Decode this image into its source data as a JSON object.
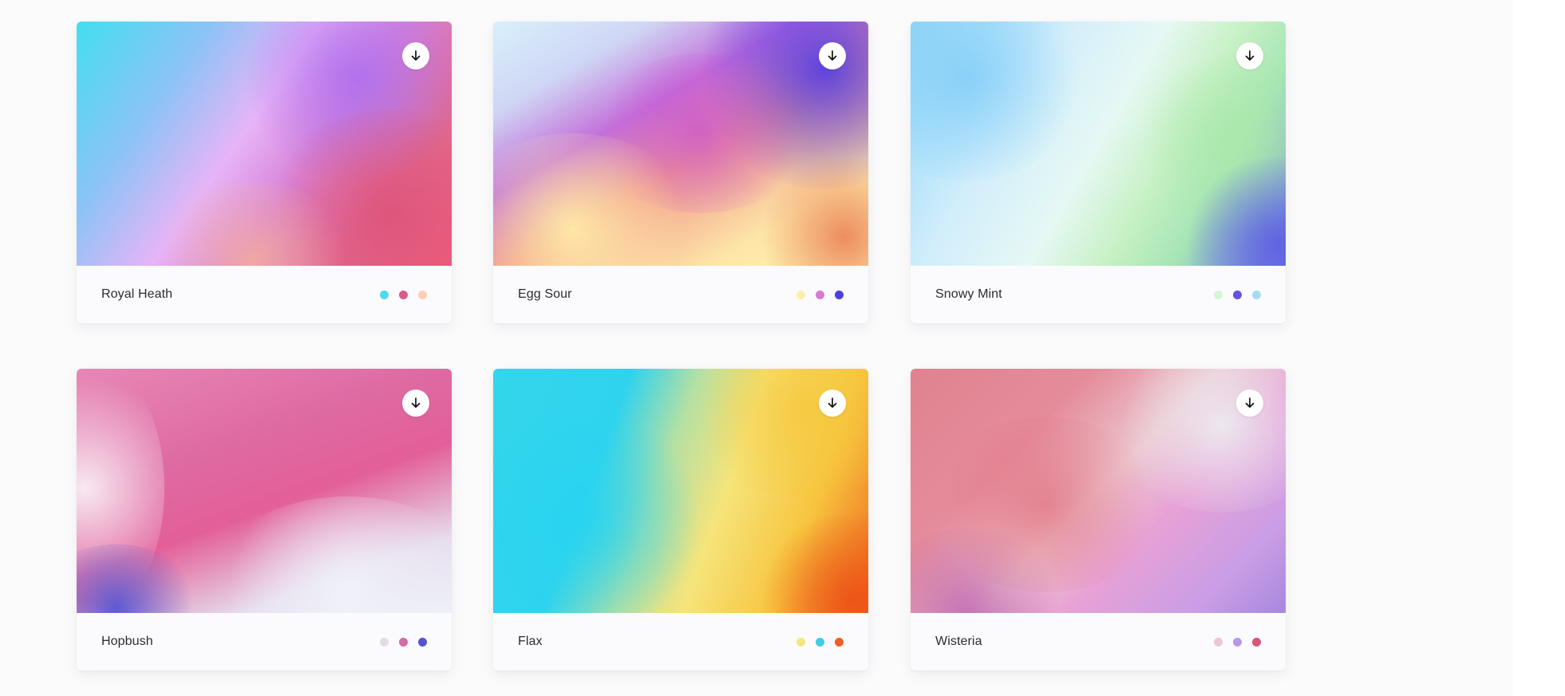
{
  "cards": [
    {
      "name": "Royal Heath",
      "colors": [
        "#4fdaf1",
        "#dc5a86",
        "#fccfb2"
      ],
      "preview_colors": [
        "#43def0",
        "#e7b4f7",
        "#c77ef0",
        "#e35c80",
        "#f6b09a"
      ]
    },
    {
      "name": "Egg Sour",
      "colors": [
        "#fbefab",
        "#d97ad0",
        "#4f3fe0"
      ],
      "preview_colors": [
        "#d9f0fb",
        "#fff3b0",
        "#c05ad6",
        "#f59282",
        "#4b3de3"
      ]
    },
    {
      "name": "Snowy Mint",
      "colors": [
        "#d6f4d6",
        "#6a4fde",
        "#a9dcf2"
      ],
      "preview_colors": [
        "#8fd6f8",
        "#e6f8f4",
        "#a6e5b5",
        "#6566e3"
      ]
    },
    {
      "name": "Hopbush",
      "colors": [
        "#e3dbe7",
        "#d769a7",
        "#5852d1"
      ],
      "preview_colors": [
        "#e35f98",
        "#eef0f8",
        "#4f5ad4",
        "#f5e9f2"
      ]
    },
    {
      "name": "Flax",
      "colors": [
        "#f5e77d",
        "#3ccfe0",
        "#ec5f27"
      ],
      "preview_colors": [
        "#2fd3ee",
        "#f6e47a",
        "#f7c43e",
        "#ec4d12"
      ]
    },
    {
      "name": "Wisteria",
      "colors": [
        "#ecc5d4",
        "#b698e8",
        "#d6557a"
      ],
      "preview_colors": [
        "#e0828f",
        "#ecc7cf",
        "#e7a1d5",
        "#a787dd"
      ]
    }
  ],
  "icons": {
    "download": "download-arrow-icon"
  }
}
